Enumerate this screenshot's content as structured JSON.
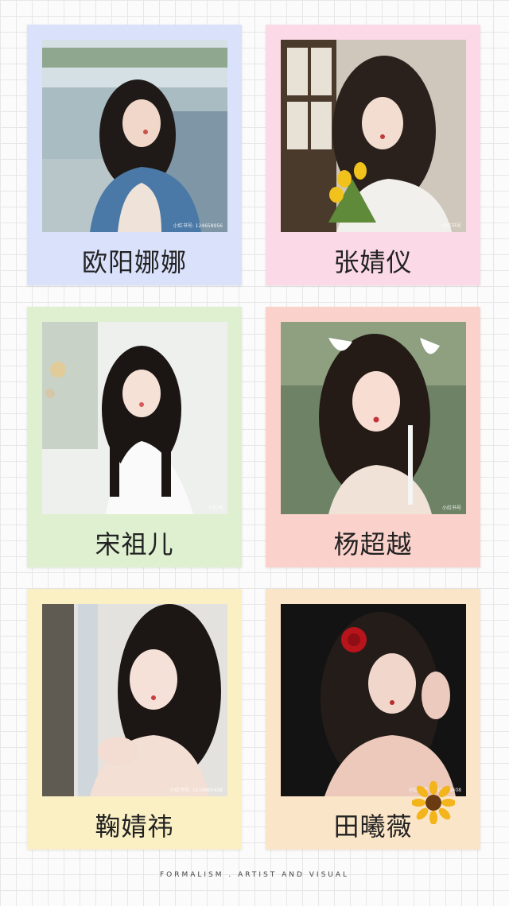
{
  "cards": [
    {
      "name": "欧阳娜娜",
      "bg": "#d9e1fb",
      "watermark": "小红书号: 124658956"
    },
    {
      "name": "张婧仪",
      "bg": "#fbd9e6",
      "watermark": "小红书号"
    },
    {
      "name": "宋祖儿",
      "bg": "#def0d0",
      "watermark": "小红书"
    },
    {
      "name": "杨超越",
      "bg": "#fbd2cb",
      "watermark": "小红书号"
    },
    {
      "name": "鞠婧祎",
      "bg": "#fbf0c4",
      "watermark": "小红书号: 1519805408"
    },
    {
      "name": "田曦薇",
      "bg": "#fbe5c8",
      "watermark": "小红书号: 1519805408"
    }
  ],
  "footer": "FORMALISM . ARTIST AND VISUAL"
}
